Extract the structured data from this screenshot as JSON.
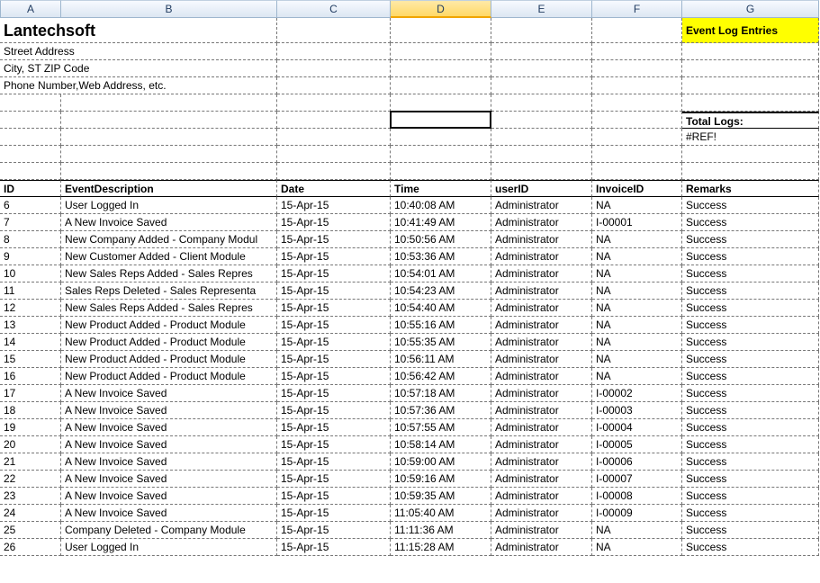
{
  "columns": [
    "A",
    "B",
    "C",
    "D",
    "E",
    "F",
    "G"
  ],
  "active_column_index": 3,
  "company": {
    "name": "Lantechsoft",
    "street": "Street Address",
    "city": "City, ST  ZIP Code",
    "contact": "Phone Number,Web Address, etc."
  },
  "banner": "Event Log Entries",
  "total_logs_label": "Total Logs:",
  "total_logs_value": "#REF!",
  "headers": {
    "id": "ID",
    "desc": "EventDescription",
    "date": "Date",
    "time": "Time",
    "user": "userID",
    "invoice": "InvoiceID",
    "remarks": "Remarks"
  },
  "rows": [
    {
      "id": "6",
      "desc": "User Logged In",
      "date": "15-Apr-15",
      "time": "10:40:08 AM",
      "user": "Administrator",
      "invoice": "NA",
      "remarks": "Success"
    },
    {
      "id": "7",
      "desc": "A New Invoice Saved",
      "date": "15-Apr-15",
      "time": "10:41:49 AM",
      "user": "Administrator",
      "invoice": "I-00001",
      "remarks": "Success"
    },
    {
      "id": "8",
      "desc": "New Company Added - Company Modul",
      "date": "15-Apr-15",
      "time": "10:50:56 AM",
      "user": "Administrator",
      "invoice": "NA",
      "remarks": "Success"
    },
    {
      "id": "9",
      "desc": "New Customer Added - Client Module",
      "date": "15-Apr-15",
      "time": "10:53:36 AM",
      "user": "Administrator",
      "invoice": "NA",
      "remarks": "Success"
    },
    {
      "id": "10",
      "desc": "New Sales Reps Added - Sales Repres",
      "date": "15-Apr-15",
      "time": "10:54:01 AM",
      "user": "Administrator",
      "invoice": "NA",
      "remarks": "Success"
    },
    {
      "id": "11",
      "desc": "Sales Reps Deleted - Sales Representa",
      "date": "15-Apr-15",
      "time": "10:54:23 AM",
      "user": "Administrator",
      "invoice": "NA",
      "remarks": "Success"
    },
    {
      "id": "12",
      "desc": "New Sales Reps Added - Sales Repres",
      "date": "15-Apr-15",
      "time": "10:54:40 AM",
      "user": "Administrator",
      "invoice": "NA",
      "remarks": "Success"
    },
    {
      "id": "13",
      "desc": "New Product Added - Product Module",
      "date": "15-Apr-15",
      "time": "10:55:16 AM",
      "user": "Administrator",
      "invoice": "NA",
      "remarks": "Success"
    },
    {
      "id": "14",
      "desc": "New Product Added - Product Module",
      "date": "15-Apr-15",
      "time": "10:55:35 AM",
      "user": "Administrator",
      "invoice": "NA",
      "remarks": "Success"
    },
    {
      "id": "15",
      "desc": "New Product Added - Product Module",
      "date": "15-Apr-15",
      "time": "10:56:11 AM",
      "user": "Administrator",
      "invoice": "NA",
      "remarks": "Success"
    },
    {
      "id": "16",
      "desc": "New Product Added - Product Module",
      "date": "15-Apr-15",
      "time": "10:56:42 AM",
      "user": "Administrator",
      "invoice": "NA",
      "remarks": "Success"
    },
    {
      "id": "17",
      "desc": "A New Invoice Saved",
      "date": "15-Apr-15",
      "time": "10:57:18 AM",
      "user": "Administrator",
      "invoice": "I-00002",
      "remarks": "Success"
    },
    {
      "id": "18",
      "desc": "A New Invoice Saved",
      "date": "15-Apr-15",
      "time": "10:57:36 AM",
      "user": "Administrator",
      "invoice": "I-00003",
      "remarks": "Success"
    },
    {
      "id": "19",
      "desc": "A New Invoice Saved",
      "date": "15-Apr-15",
      "time": "10:57:55 AM",
      "user": "Administrator",
      "invoice": "I-00004",
      "remarks": "Success"
    },
    {
      "id": "20",
      "desc": "A New Invoice Saved",
      "date": "15-Apr-15",
      "time": "10:58:14 AM",
      "user": "Administrator",
      "invoice": "I-00005",
      "remarks": "Success"
    },
    {
      "id": "21",
      "desc": "A New Invoice Saved",
      "date": "15-Apr-15",
      "time": "10:59:00 AM",
      "user": "Administrator",
      "invoice": "I-00006",
      "remarks": "Success"
    },
    {
      "id": "22",
      "desc": "A New Invoice Saved",
      "date": "15-Apr-15",
      "time": "10:59:16 AM",
      "user": "Administrator",
      "invoice": "I-00007",
      "remarks": "Success"
    },
    {
      "id": "23",
      "desc": "A New Invoice Saved",
      "date": "15-Apr-15",
      "time": "10:59:35 AM",
      "user": "Administrator",
      "invoice": "I-00008",
      "remarks": "Success"
    },
    {
      "id": "24",
      "desc": "A New Invoice Saved",
      "date": "15-Apr-15",
      "time": "11:05:40 AM",
      "user": "Administrator",
      "invoice": "I-00009",
      "remarks": "Success"
    },
    {
      "id": "25",
      "desc": "Company Deleted - Company Module",
      "date": "15-Apr-15",
      "time": "11:11:36 AM",
      "user": "Administrator",
      "invoice": "NA",
      "remarks": "Success"
    },
    {
      "id": "26",
      "desc": "User Logged In",
      "date": "15-Apr-15",
      "time": "11:15:28 AM",
      "user": "Administrator",
      "invoice": "NA",
      "remarks": "Success"
    }
  ]
}
